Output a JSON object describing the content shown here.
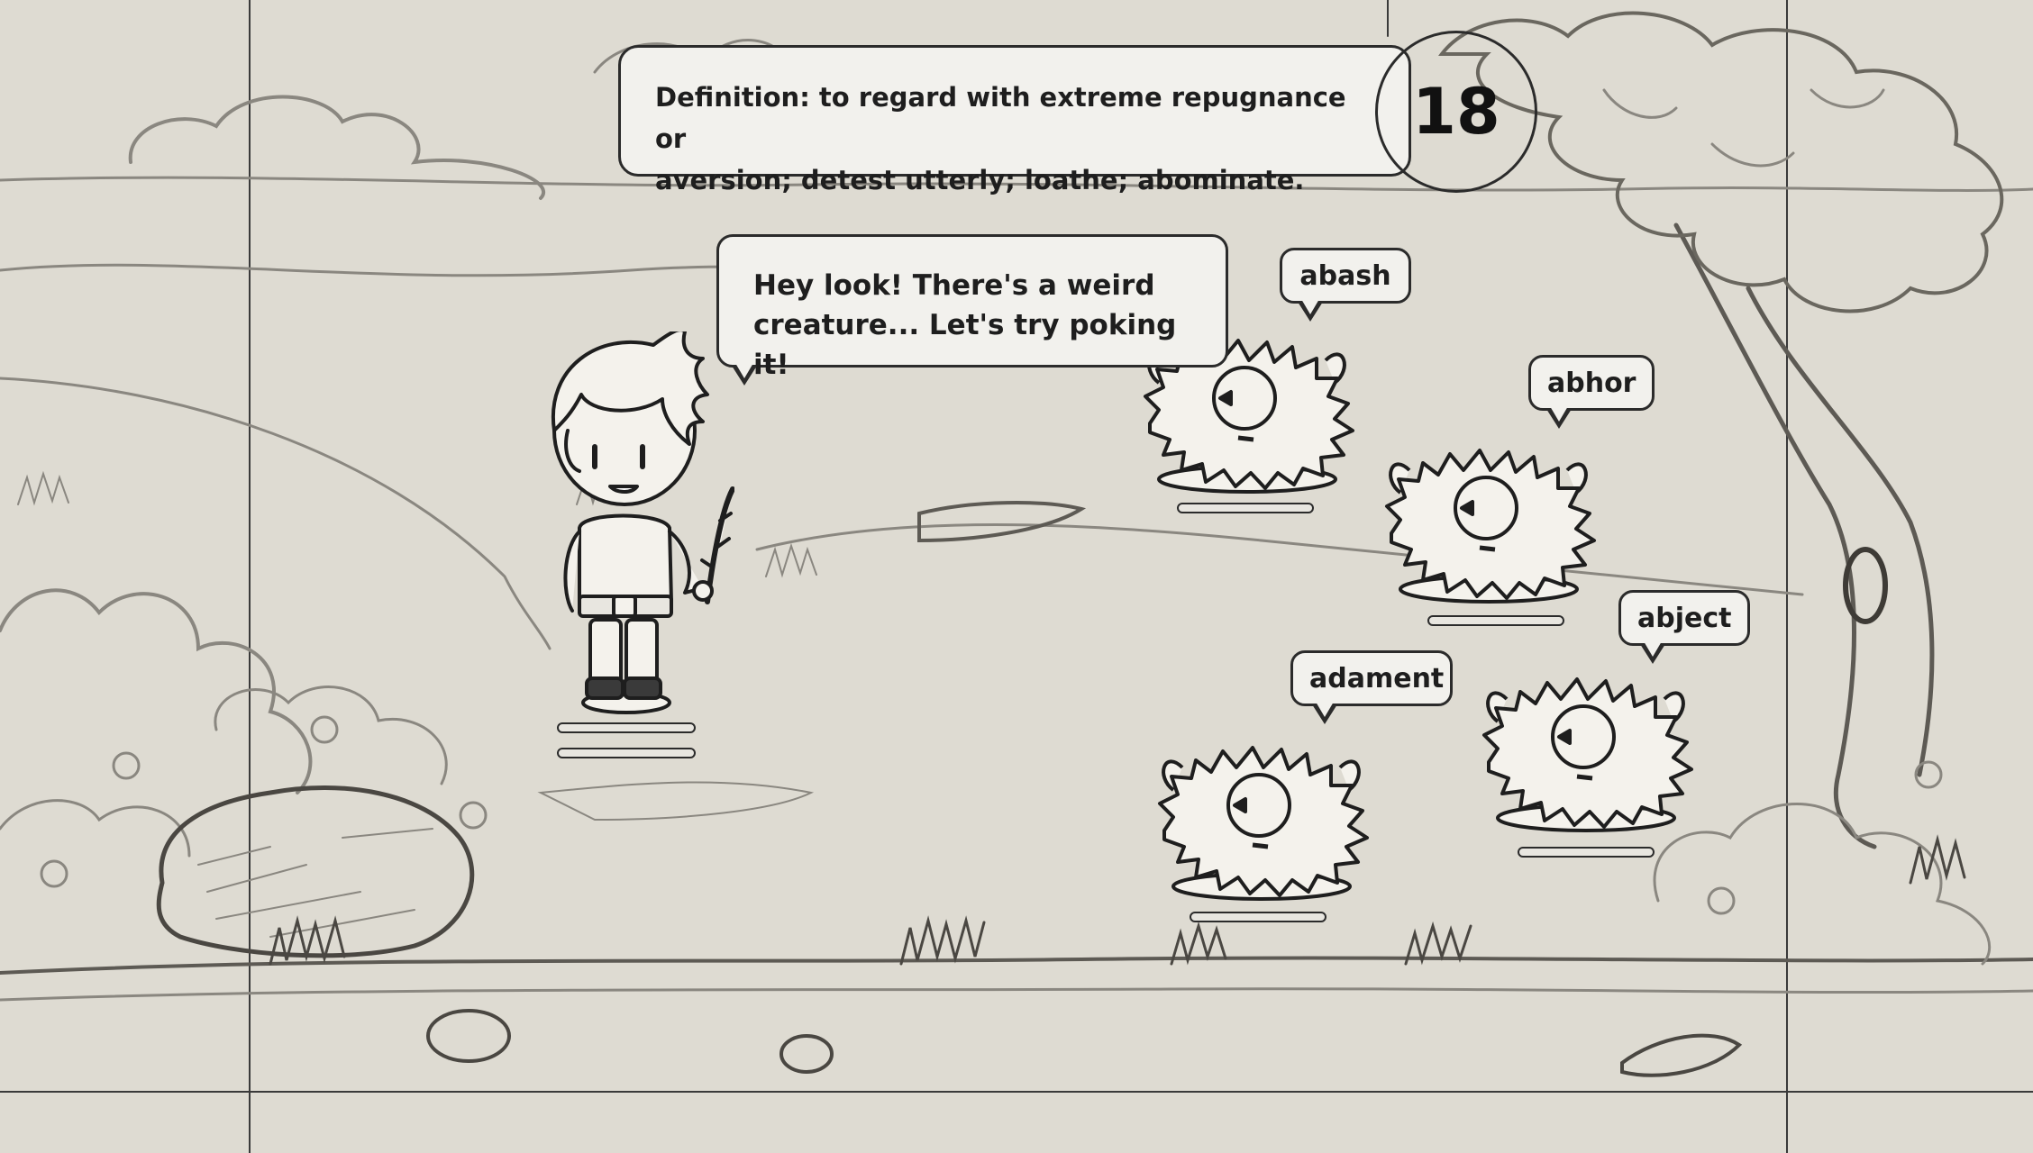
{
  "definition": {
    "line1": "Definition: to regard with extreme repugnance or",
    "line2": "aversion; detest utterly; loathe; abominate."
  },
  "turn_counter": "18",
  "dialogue": {
    "line1": "Hey look! There's a weird",
    "line2": "creature... Let's try poking it!"
  },
  "word_choices": [
    "abash",
    "abhor",
    "abject",
    "adament"
  ],
  "colors": {
    "paper": "#dedbd2",
    "ink": "#2b2b2b",
    "panel": "#f2f1ed"
  }
}
